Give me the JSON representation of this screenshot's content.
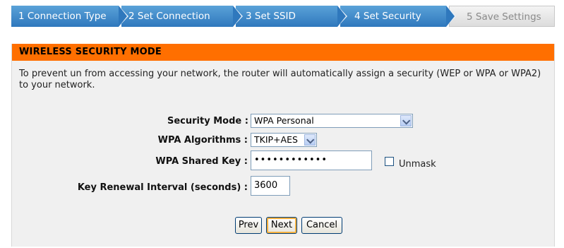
{
  "wizard": {
    "steps": [
      {
        "label": "1 Connection Type"
      },
      {
        "label": "2 Set Connection"
      },
      {
        "label": "3 Set SSID"
      },
      {
        "label": "4 Set Security"
      },
      {
        "label": "5 Save Settings"
      }
    ]
  },
  "panel": {
    "title": "WIRELESS SECURITY MODE",
    "description": "To prevent un from accessing your network, the router will automatically assign a security (WEP or WPA or WPA2) to your network."
  },
  "form": {
    "security_mode": {
      "label": "Security Mode :",
      "value": "WPA Personal"
    },
    "wpa_algorithms": {
      "label": "WPA Algorithms :",
      "value": "TKIP+AES"
    },
    "wpa_shared_key": {
      "label": "WPA Shared Key :",
      "value": "••••••••••••",
      "unmask_label": "Unmask"
    },
    "key_renewal": {
      "label": "Key Renewal Interval (seconds) :",
      "value": "3600"
    }
  },
  "buttons": {
    "prev": "Prev",
    "next": "Next",
    "cancel": "Cancel"
  },
  "colors": {
    "header_orange": "#ff6f00",
    "step_blue": "#2f78bd"
  }
}
